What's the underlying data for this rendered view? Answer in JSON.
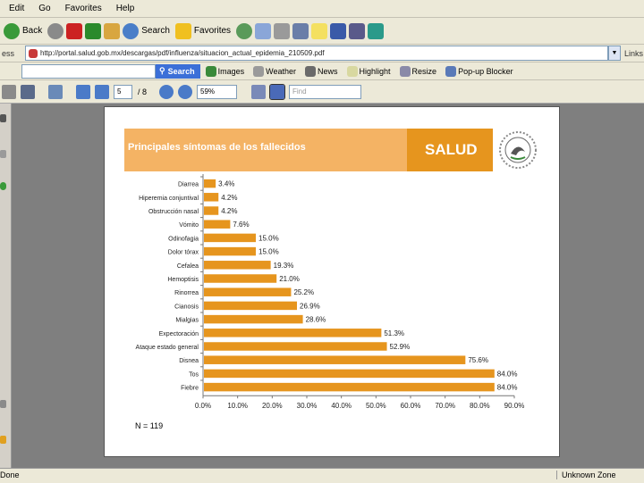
{
  "menu": [
    "Edit",
    "Go",
    "Favorites",
    "Help"
  ],
  "toolbar": {
    "back": "Back",
    "search": "Search",
    "favorites": "Favorites"
  },
  "address": {
    "label": "ess",
    "url": "http://portal.salud.gob.mx/descargas/pdf/influenza/situacion_actual_epidemia_210509.pdf",
    "links": "Links"
  },
  "searchbar": {
    "search_button": "Search",
    "items": [
      "Images",
      "Weather",
      "News",
      "Highlight",
      "Resize",
      "Pop-up Blocker"
    ]
  },
  "pdf": {
    "page_current": "5",
    "page_total": "/ 8",
    "zoom": "59%",
    "find_placeholder": "Find"
  },
  "banner": {
    "title": "Principales síntomas de los fallecidos",
    "salud": "SALUD"
  },
  "chart_data": {
    "type": "bar",
    "orientation": "horizontal",
    "categories": [
      "Diarrea",
      "Hiperemia conjuntival",
      "Obstrucción nasal",
      "Vómito",
      "Odinofagia",
      "Dolor tórax",
      "Cefalea",
      "Hemoptisis",
      "Rinorrea",
      "Cianosis",
      "Mialgias",
      "Expectoración",
      "Ataque estado general",
      "Disnea",
      "Tos",
      "Fiebre"
    ],
    "values": [
      3.4,
      4.2,
      4.2,
      7.6,
      15.0,
      15.0,
      19.3,
      21.0,
      25.2,
      26.9,
      28.6,
      51.3,
      52.9,
      75.6,
      84.0,
      84.0
    ],
    "data_labels": [
      "3.4%",
      "4.2%",
      "4.2%",
      "7.6%",
      "15.0%",
      "15.0%",
      "19.3%",
      "21.0%",
      "25.2%",
      "26.9%",
      "28.6%",
      "51.3%",
      "52.9%",
      "75.6%",
      "84.0%",
      "84.0%"
    ],
    "xticks": [
      "0.0%",
      "10.0%",
      "20.0%",
      "30.0%",
      "40.0%",
      "50.0%",
      "60.0%",
      "70.0%",
      "80.0%",
      "90.0%"
    ],
    "xlim": [
      0,
      90
    ],
    "bar_color": "#e6951e",
    "grid": false
  },
  "note": "N = 119",
  "status": {
    "left": "Done",
    "right": "Unknown Zone"
  },
  "colors": {
    "banner_light": "#f4b364",
    "banner_dark": "#e6951e",
    "viewer_bg": "#7f7f7f"
  }
}
